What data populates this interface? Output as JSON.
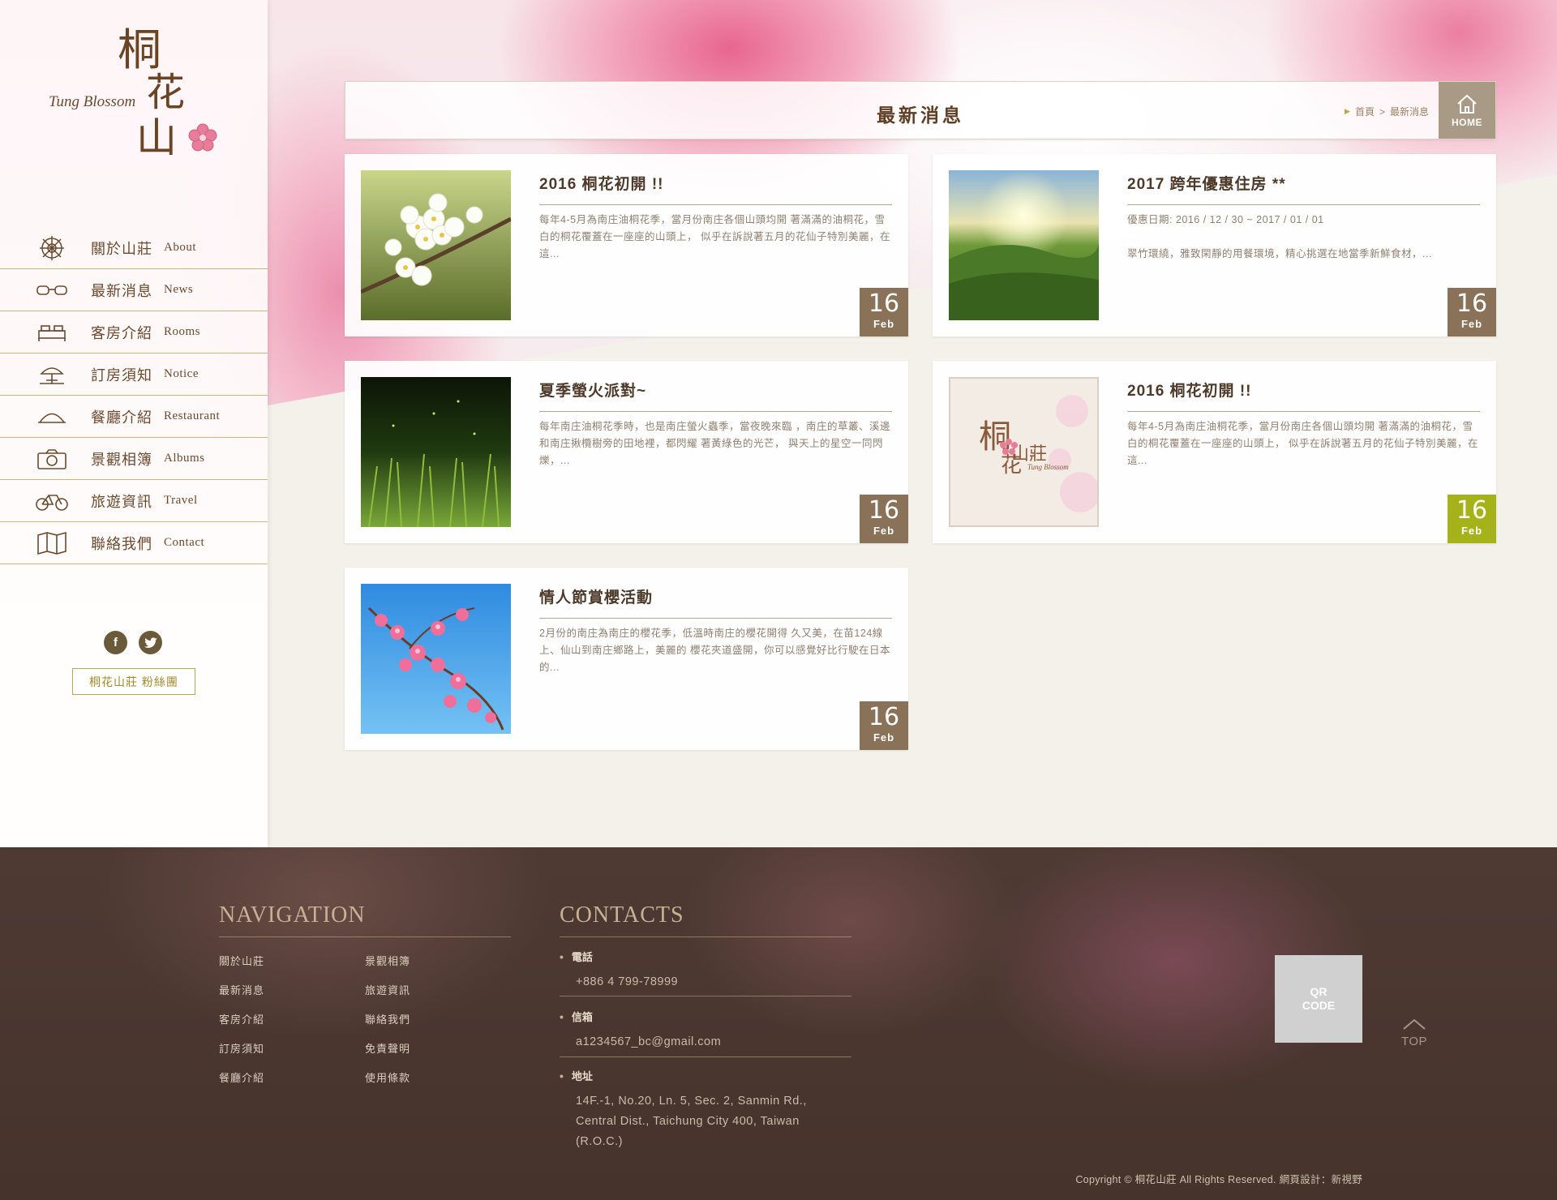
{
  "brand": {
    "logo_en": "Tung Blossom",
    "logo_chars": [
      "桐",
      "花",
      "山",
      "莊"
    ],
    "accent": "#8a7259",
    "accent_green": "#a5b21a",
    "gold": "#b9a94a"
  },
  "nav": {
    "items": [
      {
        "zh": "關於山莊",
        "en": "About",
        "icon": "compass-wheel-icon"
      },
      {
        "zh": "最新消息",
        "en": "News",
        "icon": "glasses-icon"
      },
      {
        "zh": "客房介紹",
        "en": "Rooms",
        "icon": "bed-icon"
      },
      {
        "zh": "訂房須知",
        "en": "Notice",
        "icon": "beach-umbrella-icon"
      },
      {
        "zh": "餐廳介紹",
        "en": "Restaurant",
        "icon": "food-cloche-icon"
      },
      {
        "zh": "景觀相簿",
        "en": "Albums",
        "icon": "camera-icon"
      },
      {
        "zh": "旅遊資訊",
        "en": "Travel",
        "icon": "bicycle-icon"
      },
      {
        "zh": "聯絡我們",
        "en": "Contact",
        "icon": "map-icon"
      }
    ]
  },
  "social": {
    "facebook": "f",
    "twitter": "t",
    "fans_label": "桐花山莊 粉絲團"
  },
  "page": {
    "title": "最新消息",
    "breadcrumb": [
      "首頁",
      ">",
      "最新消息"
    ],
    "home_label": "HOME"
  },
  "news": [
    {
      "title": "2016 桐花初開 !!",
      "text": "每年4-5月為南庄油桐花季，當月份南庄各個山頭均開 著滿滿的油桐花，雪白的桐花覆蓋在一座座的山頭上， 似乎在訴說著五月的花仙子特別美麗，在這...",
      "day": "16",
      "month": "Feb",
      "thumb": "white-blossom"
    },
    {
      "title": "2017 跨年優惠住房 **",
      "text_line1": "優惠日期: 2016 / 12 / 30 ~ 2017 / 01 / 01",
      "text_line2": "翠竹環繞，雅致閑靜的用餐環境，精心挑選在地當季新鮮食材，...",
      "day": "16",
      "month": "Feb",
      "thumb": "green-hills"
    },
    {
      "title": "夏季螢火派對~",
      "text": "每年南庄油桐花季時，也是南庄螢火蟲季，當夜晚來臨 ，南庄的草叢、溪邊和南庄揪欖樹旁的田地裡，都閃耀 著黃綠色的光芒， 與天上的星空一同閃爍，...",
      "day": "16",
      "month": "Feb",
      "thumb": "firefly-grass"
    },
    {
      "title": "2016 桐花初開 !!",
      "text": "每年4-5月為南庄油桐花季，當月份南庄各個山頭均開 著滿滿的油桐花，雪白的桐花覆蓋在一座座的山頭上， 似乎在訴說著五月的花仙子特別美麗，在這...",
      "day": "16",
      "month": "Feb",
      "thumb": "logo-card",
      "highlight": true
    },
    {
      "title": "情人節賞櫻活動",
      "text": "2月份的南庄為南庄的櫻花季，低溫時南庄的櫻花開得 久又美，在苗124線上、仙山到南庄鄉路上，美麗的 櫻花夾道盛開，你可以感覺好比行駛在日本的...",
      "day": "16",
      "month": "Feb",
      "thumb": "cherry-sky"
    }
  ],
  "footer": {
    "nav_heading": "NAVIGATION",
    "nav_col1": [
      "關於山莊",
      "最新消息",
      "客房介紹",
      "訂房須知",
      "餐廳介紹"
    ],
    "nav_col2": [
      "景觀相簿",
      "旅遊資訊",
      "聯絡我們",
      "免責聲明",
      "使用條款"
    ],
    "contacts_heading": "CONTACTS",
    "phone_label": "電話",
    "phone": "+886 4 799-78999",
    "email_label": "信箱",
    "email": "a1234567_bc@gmail.com",
    "address_label": "地址",
    "address_lines": [
      "14F.-1, No.20, Ln. 5, Sec. 2, Sanmin Rd.,",
      "Central Dist., Taichung City 400, Taiwan",
      "(R.O.C.)"
    ],
    "qr_line1": "QR",
    "qr_line2": "CODE",
    "top_label": "TOP",
    "copyright": "Copyright © 桐花山莊 All Rights Reserved.   網頁設計：新視野"
  }
}
